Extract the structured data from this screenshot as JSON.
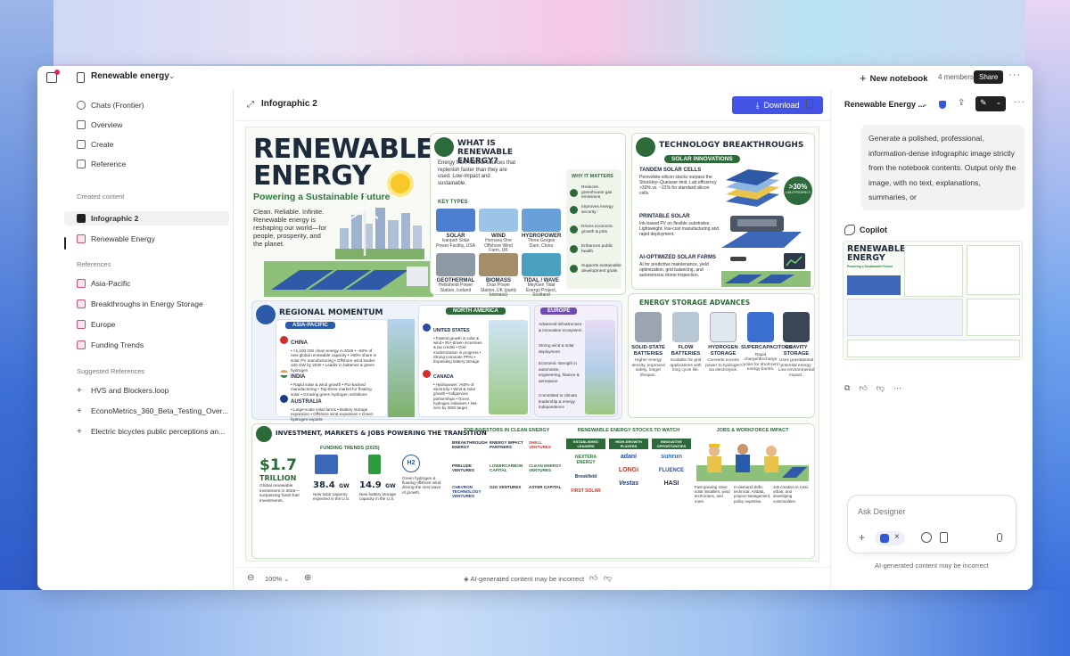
{
  "topbar": {
    "notebook_title": "Renewable energy",
    "new_notebook_label": "New notebook",
    "members": "4 members",
    "share_label": "Share"
  },
  "sidebar": {
    "nav": [
      {
        "label": "Chats (Frontier)",
        "icon": "chat-icon"
      },
      {
        "label": "Overview",
        "icon": "overview-icon"
      },
      {
        "label": "Create",
        "icon": "create-icon"
      },
      {
        "label": "Reference",
        "icon": "reference-icon"
      }
    ],
    "created_heading": "Created content",
    "created": [
      {
        "label": "Infographic 2",
        "active": true
      },
      {
        "label": "Renewable Energy"
      }
    ],
    "references_heading": "References",
    "references": [
      "Asia-Pacific",
      "Breakthroughs in Energy Storage",
      "Europe",
      "Funding Trends"
    ],
    "suggested_heading": "Suggested References",
    "suggested": [
      "HVS and Blockers.loop",
      "EconoMetrics_360_Beta_Testing_Over...",
      "Electric bicycles public perceptions an..."
    ]
  },
  "main": {
    "title": "Infographic 2",
    "download_label": "Download",
    "zoom": "100%",
    "ai_note": "AI-generated content may be incorrect"
  },
  "infographic": {
    "title_line1": "RENEWABLE",
    "title_line2": "ENERGY",
    "subtitle": "Powering a Sustainable Future",
    "tagline": "Clean. Reliable. Infinite. Renewable energy is reshaping our world—for people, prosperity, and the planet.",
    "what_is": {
      "heading": "WHAT IS RENEWABLE ENERGY?",
      "body": "Energy from natural sources that replenish faster than they are used. Low-impact and sustainable.",
      "key_types_label": "KEY TYPES",
      "types": [
        {
          "name": "SOLAR",
          "desc": "Ivanpah Solar Power Facility, USA",
          "color": "#4d7fd1"
        },
        {
          "name": "WIND",
          "desc": "Hornsea One Offshore Wind Farm, UK",
          "color": "#9cc3e8"
        },
        {
          "name": "HYDROPOWER",
          "desc": "Three Gorges Dam, China",
          "color": "#6aa0d8"
        },
        {
          "name": "GEOTHERMAL",
          "desc": "Hellisheidi Power Station, Iceland",
          "color": "#8d9aa6"
        },
        {
          "name": "BIOMASS",
          "desc": "Drax Power Station, UK (partly biomass)",
          "color": "#a68d6a"
        },
        {
          "name": "TIDAL / WAVE",
          "desc": "MeyGen Tidal Energy Project, Scotland",
          "color": "#4aa0c0"
        }
      ],
      "why_label": "WHY IT MATTERS",
      "why": [
        "Reduces greenhouse gas emissions",
        "Improves energy security",
        "Drives economic growth & jobs",
        "Enhances public health",
        "Supports sustainable development goals"
      ]
    },
    "tech": {
      "heading": "TECHNOLOGY BREAKTHROUGHS",
      "solar_tag": "SOLAR INNOVATIONS",
      "items": [
        {
          "title": "TANDEM SOLAR CELLS",
          "desc": "Perovskite-silicon stacks surpass the Shockley–Queisser limit. Lab efficiency >30% vs. ~22% for standard silicon cells."
        },
        {
          "title": "PRINTABLE SOLAR",
          "desc": "Ink-based PV on flexible substrates. Lightweight, low-cost manufacturing and rapid deployment."
        },
        {
          "title": "AI-OPTIMIZED SOLAR FARMS",
          "desc": "AI for predictive maintenance, yield optimization, grid balancing, and autonomous drone inspection."
        }
      ],
      "badge_value": ">30%",
      "badge_label": "LAB EFFICIENCY"
    },
    "storage": {
      "heading": "ENERGY STORAGE ADVANCES",
      "items": [
        {
          "name": "SOLID-STATE BATTERIES",
          "desc": "Higher energy density, improved safety, longer lifespan.",
          "color": "#9aa5b1"
        },
        {
          "name": "FLOW BATTERIES",
          "desc": "Scalable for grid applications with long cycle life.",
          "color": "#b8c7d4"
        },
        {
          "name": "HYDROGEN STORAGE",
          "desc": "Converts excess power to hydrogen via electrolysis.",
          "color": "#dfe6ee"
        },
        {
          "name": "SUPERCAPACITORS",
          "desc": "Rapid charge/discharge cycles for short-term energy bursts.",
          "color": "#3b6fd0"
        },
        {
          "name": "GRAVITY STORAGE",
          "desc": "Uses gravitational potential energy. Low environmental impact.",
          "color": "#3a4656"
        }
      ]
    },
    "regional": {
      "heading": "REGIONAL MOMENTUM",
      "asia": {
        "tag": "ASIA-PACIFIC",
        "countries": [
          {
            "name": "CHINA",
            "points": "• >1,100 GW clean energy in 2025 • ~60% of new global renewable capacity • >80% share in solar PV manufacturing • Offshore wind leader: 130 GW by 2030 • Leader in batteries & green hydrogen"
          },
          {
            "name": "INDIA",
            "points": "• Rapid solar & wind growth • PLI-backed manufacturing • Top-three market for floating solar • Growing green hydrogen ambitions"
          },
          {
            "name": "AUSTRALIA",
            "points": "• Large-scale solar farms • Battery storage expansion • Offshore wind expansion • Green hydrogen exports"
          }
        ]
      },
      "na": {
        "tag": "NORTH AMERICA",
        "countries": [
          {
            "name": "UNITED STATES",
            "points": "• Fastest growth in solar & wind • IRA-driven incentives & tax credits • Grid modernization in progress • Strong corporate PPAs • Expanding battery storage"
          },
          {
            "name": "CANADA",
            "points": "• Hydropower: >60% of electricity • Wind & solar growth • Indigenous partnerships • Green hydrogen initiatives • Net-zero by 2050 target"
          }
        ]
      },
      "eu": {
        "tag": "EUROPE",
        "points": [
          "Advanced infrastructure & innovation ecosystem",
          "Strong wind & solar deployment",
          "Economic strength in automotive, engineering, finance & aerospace",
          "Committed to climate leadership & energy independence"
        ]
      }
    },
    "invest": {
      "heading": "INVESTMENT, MARKETS & JOBS POWERING THE TRANSITION",
      "funding_label": "FUNDING TRENDS (2025)",
      "kpis": [
        {
          "value": "$1.7",
          "unit": "TRILLION",
          "desc": "Global renewable investment in 2025—surpassing fossil fuel investments."
        },
        {
          "value": "38.4",
          "unit": "GW",
          "desc": "New solar capacity expected in the U.S."
        },
        {
          "value": "14.9",
          "unit": "GW",
          "desc": "New battery storage capacity in the U.S."
        },
        {
          "value": "H2",
          "unit": "",
          "desc": "Green hydrogen & floating offshore wind driving the next wave of growth."
        }
      ],
      "investors_label": "TOP INVESTORS IN CLEAN ENERGY",
      "investors": [
        "BREAKTHROUGH ENERGY",
        "ENERGY IMPACT PARTNERS",
        "SHELL VENTURES",
        "PRELUDE VENTURES",
        "LOWERCARBON CAPITAL",
        "CLEAN ENERGY VENTURES",
        "CHEVRON TECHNOLOGY VENTURES",
        "S2G VENTURES",
        "ASTER CAPITAL"
      ],
      "stocks_label": "RENEWABLE ENERGY STOCKS TO WATCH",
      "stock_cols": [
        {
          "head": "ESTABLISHED LEADERS",
          "names": [
            "NEXTERA ENERGY",
            "Brookfield",
            "FIRST SOLAR"
          ]
        },
        {
          "head": "HIGH-GROWTH PLAYERS",
          "names": [
            "adani",
            "LONGi",
            "Vestas"
          ]
        },
        {
          "head": "INNOVATIVE OPPORTUNITIES",
          "names": [
            "sunrun",
            "FLUENCE",
            "HASI"
          ]
        }
      ],
      "jobs_label": "JOBS & WORKFORCE IMPACT",
      "jobs": [
        "Fast-growing roles: solar installers, wind technicians, and more.",
        "In-demand skills: technical, AI/data, project management, policy expertise.",
        "Job creation in rural, urban, and developing communities."
      ]
    }
  },
  "rightpanel": {
    "title": "Renewable Energy ...",
    "prompt": "Generate a polished, professional, information-dense infographic image strictly from the notebook contents. Output only the image, with no text, explanations, summaries, or",
    "copilot_label": "Copilot",
    "ask_placeholder": "Ask Designer",
    "footer": "AI-generated content may be incorrect"
  }
}
